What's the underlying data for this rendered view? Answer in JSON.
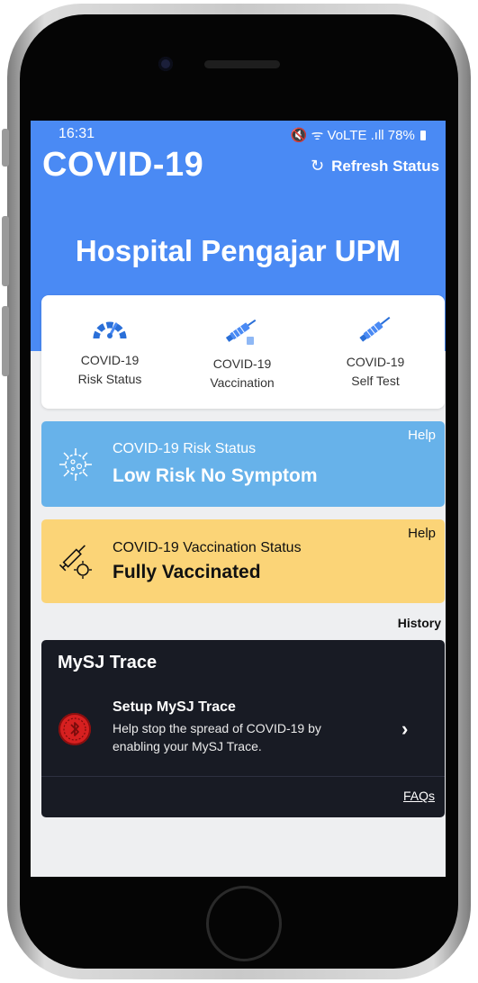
{
  "status_bar": {
    "time": "16:31",
    "battery": "78%",
    "icons": "🔇 ᯤ VoLTE .ıll"
  },
  "header": {
    "app_title": "COVID-19",
    "refresh_label": "Refresh Status",
    "refresh_icon": "refresh-icon",
    "hospital_name": "Hospital Pengajar UPM"
  },
  "quick_actions": [
    {
      "line1": "COVID-19",
      "line2": "Risk Status",
      "icon": "gauge-icon"
    },
    {
      "line1": "COVID-19",
      "line2": "Vaccination",
      "icon": "vaccine-icon"
    },
    {
      "line1": "COVID-19",
      "line2": "Self Test",
      "icon": "syringe-icon"
    }
  ],
  "risk_card": {
    "label": "COVID-19 Risk Status",
    "value": "Low Risk No Symptom",
    "help": "Help",
    "color": "#67b2ea"
  },
  "vaccination_card": {
    "label": "COVID-19 Vaccination Status",
    "value": "Fully Vaccinated",
    "help": "Help",
    "color": "#fbd477"
  },
  "history_label": "History",
  "trace": {
    "title": "MySJ Trace",
    "setup_title": "Setup MySJ Trace",
    "setup_desc_line1": "Help stop the spread of COVID-19 by",
    "setup_desc_line2": "enabling your MySJ Trace.",
    "chevron": "›",
    "faqs": "FAQs",
    "icon_color": "#d62020"
  },
  "colors": {
    "accent": "#4a8af4",
    "trace_bg": "#181b24"
  }
}
